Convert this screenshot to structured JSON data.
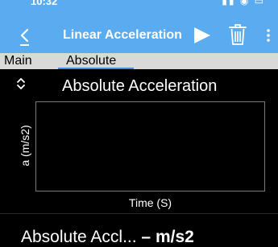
{
  "status_bar": {
    "time": "10:32",
    "icons": [
      "signal-icon",
      "wifi-icon",
      "battery-icon"
    ]
  },
  "nav": {
    "back_label": "<",
    "title": "Linear Acceleration",
    "actions": [
      "play-icon",
      "trash-icon",
      "more-vertical-icon"
    ]
  },
  "tabs": {
    "items": [
      {
        "label": "Main",
        "selected": false
      },
      {
        "label": "Absolute",
        "selected": true
      }
    ]
  },
  "chart": {
    "title": "Absolute Acceleration",
    "ylabel": "a (m/s2)",
    "xlabel": "Time (S)"
  },
  "readout": {
    "label": "Absolute Accl...",
    "value": "–",
    "unit": "m/s2"
  },
  "colors": {
    "nav_background": "#5aabf0",
    "tab_background": "#d9d9d9",
    "tab_underline": "#3b8fe0",
    "page_background": "#000000",
    "plot_border": "#7a7a7a"
  }
}
